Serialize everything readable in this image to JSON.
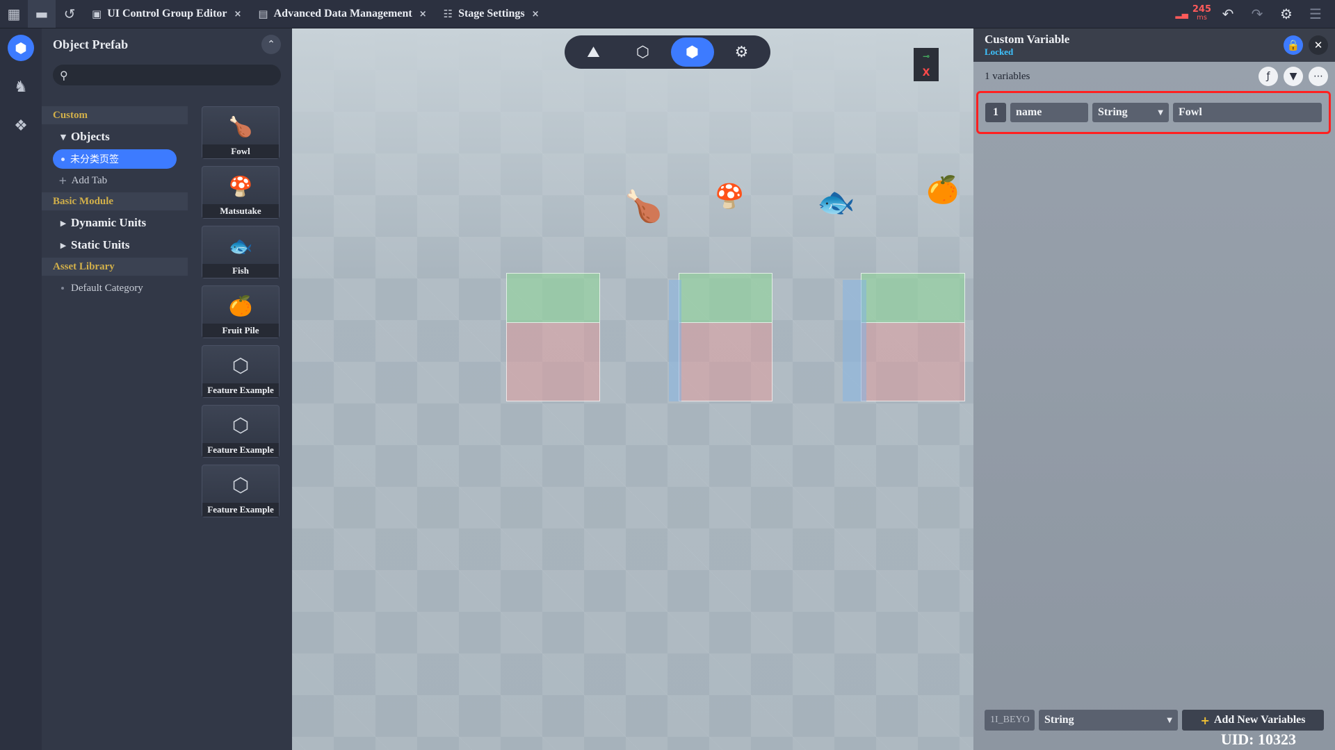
{
  "topbar": {
    "tabs": [
      {
        "icon": "ui",
        "label": "UI Control Group Editor"
      },
      {
        "icon": "doc",
        "label": "Advanced Data Management"
      },
      {
        "icon": "stage",
        "label": "Stage Settings"
      }
    ],
    "close_glyph": "×",
    "ping_value": "245",
    "ping_unit": "ms"
  },
  "prefab": {
    "title": "Object Prefab",
    "search_placeholder": "",
    "sections": {
      "custom": "Custom",
      "objects": "Objects",
      "selected_tab": "未分类页签",
      "add_tab": "Add Tab",
      "basic_module": "Basic Module",
      "dynamic_units": "Dynamic Units",
      "static_units": "Static Units",
      "asset_library": "Asset Library",
      "default_category": "Default Category"
    },
    "cards": [
      {
        "label": "Fowl",
        "thumb": "🍗"
      },
      {
        "label": "Matsutake",
        "thumb": "🍄"
      },
      {
        "label": "Fish",
        "thumb": "🐟"
      },
      {
        "label": "Fruit Pile",
        "thumb": "🍊"
      },
      {
        "label": "Feature Example",
        "thumb": "⬡"
      },
      {
        "label": "Feature Example",
        "thumb": "⬡"
      },
      {
        "label": "Feature Example",
        "thumb": "⬡"
      }
    ]
  },
  "viewport": {
    "gizmo_top": "⊸",
    "gizmo_bottom": "X"
  },
  "variables": {
    "title": "Custom Variable",
    "status": "Locked",
    "count_label": "1 variables",
    "rows": [
      {
        "index": "1",
        "name": "name",
        "type": "String",
        "value": "Fowl"
      }
    ],
    "new_id": "1I_BEYO",
    "new_type": "String",
    "add_label": "Add New Variables",
    "uid": "UID: 10323"
  },
  "colors": {
    "accent": "#3d7bff",
    "highlight_border": "#ff2020",
    "section_text": "#d2b04a",
    "locked_text": "#3ec3ff"
  }
}
